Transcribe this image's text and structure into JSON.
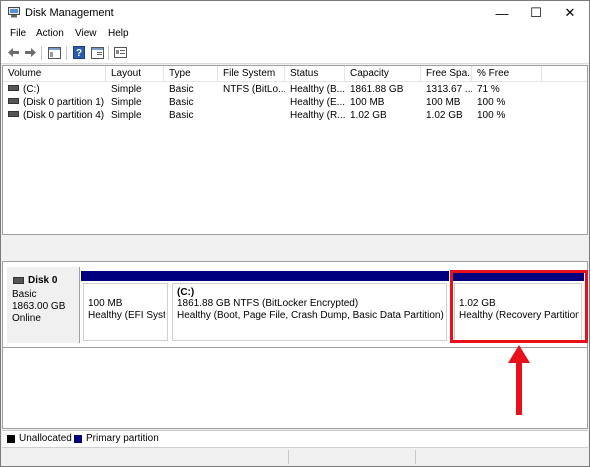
{
  "window": {
    "title": "Disk Management",
    "minimize": "—",
    "maximize": "☐",
    "close": "✕"
  },
  "menu": [
    "File",
    "Action",
    "View",
    "Help"
  ],
  "columns": [
    "Volume",
    "Layout",
    "Type",
    "File System",
    "Status",
    "Capacity",
    "Free Spa...",
    "% Free"
  ],
  "volumes": [
    {
      "volume": "(C:)",
      "layout": "Simple",
      "type": "Basic",
      "fs": "NTFS (BitLo...",
      "status": "Healthy (B...",
      "capacity": "1861.88 GB",
      "free": "1313.67 ...",
      "pct": "71 %"
    },
    {
      "volume": "(Disk 0 partition 1)",
      "layout": "Simple",
      "type": "Basic",
      "fs": "",
      "status": "Healthy (E...",
      "capacity": "100 MB",
      "free": "100 MB",
      "pct": "100 %"
    },
    {
      "volume": "(Disk 0 partition 4)",
      "layout": "Simple",
      "type": "Basic",
      "fs": "",
      "status": "Healthy (R...",
      "capacity": "1.02 GB",
      "free": "1.02 GB",
      "pct": "100 %"
    }
  ],
  "disk": {
    "name": "Disk 0",
    "type": "Basic",
    "size": "1863.00 GB",
    "state": "Online",
    "partitions": [
      {
        "title": "",
        "line1": "100 MB",
        "line2": "Healthy (EFI System Partition)"
      },
      {
        "title": "(C:)",
        "line1": "1861.88 GB NTFS (BitLocker Encrypted)",
        "line2": "Healthy (Boot, Page File, Crash Dump, Basic Data Partition)"
      },
      {
        "title": "",
        "line1": "1.02 GB",
        "line2": "Healthy (Recovery Partition)"
      }
    ]
  },
  "legend": [
    {
      "label": "Unallocated",
      "color": "#000000"
    },
    {
      "label": "Primary partition",
      "color": "#00007f"
    }
  ],
  "colors": {
    "primary_bar": "#00007f",
    "highlight": "#e8101b"
  }
}
